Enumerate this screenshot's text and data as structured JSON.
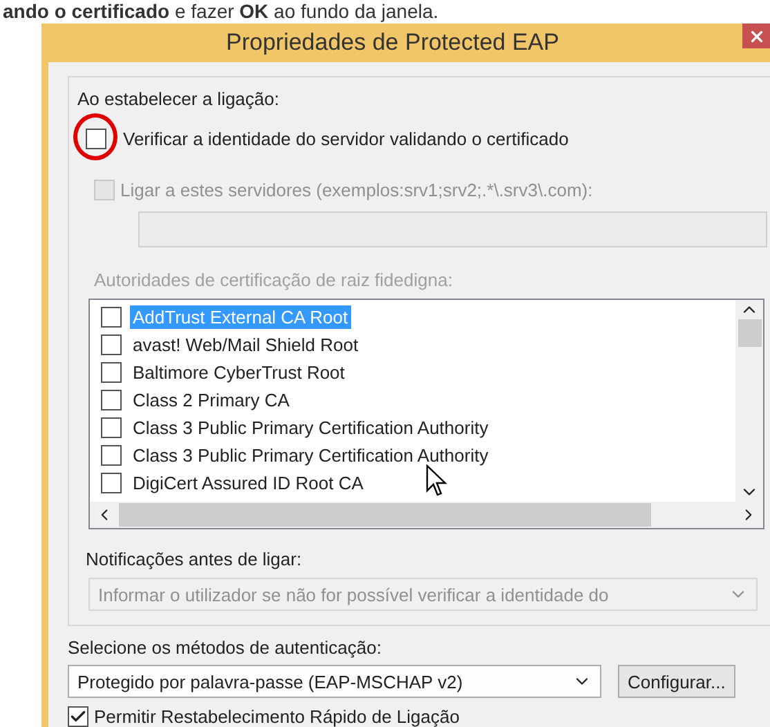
{
  "caption": "**ando o certificado** e fazer **OK** ao fundo da janela.",
  "dialog": {
    "title": "Propriedades de Protected EAP",
    "connection_label": "Ao estabelecer a ligação:",
    "verify_checkbox": {
      "label": "Verificar a identidade do servidor validando o certificado",
      "checked": false
    },
    "servers_checkbox": {
      "label": "Ligar a estes servidores (exemplos:srv1;srv2;.*\\.srv3\\.com):",
      "checked": false,
      "disabled": true
    },
    "servers_field": {
      "disabled": true
    },
    "trusted_ca": {
      "label": "Autoridades de certificação de raiz fidedigna:",
      "disabled": true,
      "items": [
        {
          "label": "AddTrust External CA Root",
          "checked": false,
          "selected": true
        },
        {
          "label": "avast! Web/Mail Shield Root",
          "checked": false,
          "selected": false
        },
        {
          "label": "Baltimore CyberTrust Root",
          "checked": false,
          "selected": false
        },
        {
          "label": "Class 2 Primary CA",
          "checked": false,
          "selected": false
        },
        {
          "label": "Class 3 Public Primary Certification Authority",
          "checked": false,
          "selected": false
        },
        {
          "label": "Class 3 Public Primary Certification Authority",
          "checked": false,
          "selected": false
        },
        {
          "label": "DigiCert Assured ID Root CA",
          "checked": false,
          "selected": false
        }
      ]
    },
    "notifications_label": "Notificações antes de ligar:",
    "notifications_select": {
      "value": "Informar o utilizador se não for possível verificar a identidade do",
      "disabled": true
    },
    "auth_label": "Selecione os métodos de autenticação:",
    "auth_select": {
      "value": "Protegido por palavra-passe (EAP-MSCHAP v2)"
    },
    "configure_button": "Configurar...",
    "fast_reconnect": {
      "label": "Permitir Restabelecimento Rápido de Ligação",
      "checked": true
    }
  }
}
